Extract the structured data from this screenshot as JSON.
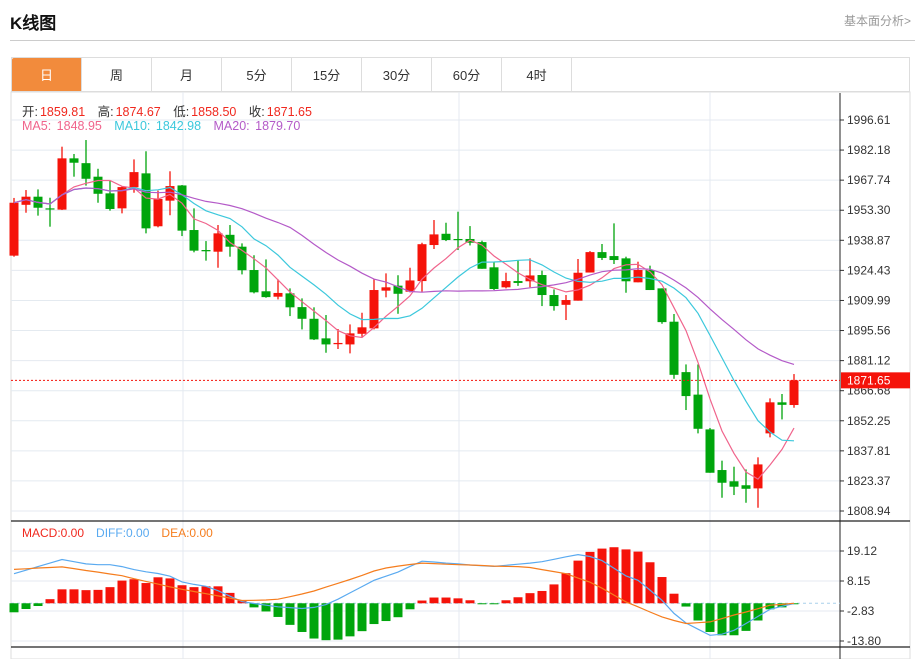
{
  "header": {
    "title": "K线图",
    "link": "基本面分析>"
  },
  "tabs": [
    {
      "label": "日",
      "active": true
    },
    {
      "label": "周"
    },
    {
      "label": "月"
    },
    {
      "label": "5分"
    },
    {
      "label": "15分"
    },
    {
      "label": "30分"
    },
    {
      "label": "60分"
    },
    {
      "label": "4时"
    }
  ],
  "ohlc_legend": {
    "open_label": "开:",
    "open": "1859.81",
    "high_label": "高:",
    "high": "1874.67",
    "low_label": "低:",
    "low": "1858.50",
    "close_label": "收:",
    "close": "1871.65"
  },
  "ma_legend": {
    "ma5_label": "MA5:",
    "ma5": "1848.95",
    "ma10_label": "MA10:",
    "ma10": "1842.98",
    "ma20_label": "MA20:",
    "ma20": "1879.70"
  },
  "macd_legend": {
    "macd": "MACD:0.00",
    "diff": "DIFF:0.00",
    "dea": "DEA:0.00"
  },
  "colors": {
    "up": "#f5130a",
    "down": "#00a50c",
    "ma5": "#f0648c",
    "ma10": "#3cc8dc",
    "ma20": "#b45ac8",
    "diff": "#5aaaf0",
    "dea": "#f57d1e",
    "accent": "#f28b3c",
    "last_price": "#f5130a"
  },
  "chart_data": [
    {
      "type": "candlestick",
      "title": "",
      "ylim": [
        1808.94,
        1996.61
      ],
      "y_ticks": [
        "1996.61",
        "1982.18",
        "1967.74",
        "1953.30",
        "1938.87",
        "1924.43",
        "1909.99",
        "1895.56",
        "1881.12",
        "1866.68",
        "1852.25",
        "1837.81",
        "1823.37",
        "1808.94"
      ],
      "last_price": "1871.65",
      "grid": true,
      "ma_periods": [
        5,
        10,
        20
      ],
      "candles": [
        [
          1931.5,
          1959.2,
          1931.0,
          1956.9
        ],
        [
          1955.9,
          1963.0,
          1952.1,
          1959.8
        ],
        [
          1959.8,
          1963.3,
          1950.7,
          1954.5
        ],
        [
          1954.2,
          1959.3,
          1945.4,
          1954.0
        ],
        [
          1953.6,
          1983.8,
          1953.4,
          1978.2
        ],
        [
          1978.2,
          1980.3,
          1969.4,
          1976.1
        ],
        [
          1975.9,
          1987.0,
          1965.1,
          1968.4
        ],
        [
          1969.4,
          1973.2,
          1956.9,
          1961.2
        ],
        [
          1961.4,
          1967.5,
          1953.1,
          1953.9
        ],
        [
          1954.2,
          1964.9,
          1951.8,
          1964.4
        ],
        [
          1964.3,
          1977.7,
          1961.7,
          1971.6
        ],
        [
          1971.0,
          1981.6,
          1942.2,
          1944.6
        ],
        [
          1945.6,
          1962.7,
          1945.1,
          1958.7
        ],
        [
          1957.9,
          1972.0,
          1950.9,
          1964.9
        ],
        [
          1965.2,
          1965.4,
          1940.9,
          1943.5
        ],
        [
          1943.8,
          1954.2,
          1933.1,
          1933.9
        ],
        [
          1934.2,
          1938.5,
          1929.1,
          1933.6
        ],
        [
          1933.4,
          1946.2,
          1925.7,
          1942.2
        ],
        [
          1941.5,
          1946.2,
          1931.0,
          1935.8
        ],
        [
          1935.8,
          1937.4,
          1922.5,
          1924.5
        ],
        [
          1924.6,
          1931.7,
          1913.4,
          1913.9
        ],
        [
          1914.4,
          1929.7,
          1911.3,
          1911.6
        ],
        [
          1911.8,
          1920.1,
          1910.5,
          1913.6
        ],
        [
          1913.4,
          1915.8,
          1902.5,
          1906.7
        ],
        [
          1906.8,
          1911.0,
          1896.1,
          1901.2
        ],
        [
          1901.2,
          1906.7,
          1891.0,
          1891.3
        ],
        [
          1891.8,
          1903.0,
          1884.9,
          1888.9
        ],
        [
          1889.0,
          1896.3,
          1886.7,
          1889.6
        ],
        [
          1888.9,
          1898.5,
          1884.6,
          1894.2
        ],
        [
          1894.0,
          1904.1,
          1892.6,
          1897.1
        ],
        [
          1896.6,
          1920.1,
          1896.1,
          1915.0
        ],
        [
          1914.7,
          1923.0,
          1911.5,
          1916.3
        ],
        [
          1917.1,
          1922.1,
          1903.6,
          1913.2
        ],
        [
          1914.2,
          1925.7,
          1913.9,
          1919.6
        ],
        [
          1919.3,
          1937.7,
          1914.2,
          1937.0
        ],
        [
          1936.6,
          1948.6,
          1934.7,
          1941.7
        ],
        [
          1942.0,
          1947.3,
          1938.5,
          1939.0
        ],
        [
          1939.5,
          1952.6,
          1934.2,
          1939.3
        ],
        [
          1939.5,
          1945.7,
          1936.4,
          1937.7
        ],
        [
          1938.0,
          1938.7,
          1925.2,
          1925.2
        ],
        [
          1925.9,
          1928.6,
          1915.0,
          1915.5
        ],
        [
          1916.3,
          1923.3,
          1915.8,
          1919.3
        ],
        [
          1919.3,
          1929.4,
          1917.0,
          1918.4
        ],
        [
          1919.2,
          1930.2,
          1916.3,
          1922.0
        ],
        [
          1922.2,
          1924.3,
          1907.3,
          1912.6
        ],
        [
          1912.6,
          1915.3,
          1905.1,
          1907.3
        ],
        [
          1907.9,
          1912.6,
          1900.6,
          1910.2
        ],
        [
          1909.9,
          1929.9,
          1909.9,
          1923.3
        ],
        [
          1923.4,
          1933.7,
          1923.4,
          1933.2
        ],
        [
          1933.2,
          1937.1,
          1929.4,
          1930.4
        ],
        [
          1931.3,
          1947.0,
          1927.5,
          1929.4
        ],
        [
          1930.2,
          1931.0,
          1913.7,
          1919.2
        ],
        [
          1918.7,
          1928.6,
          1918.7,
          1924.6
        ],
        [
          1924.6,
          1926.7,
          1915.0,
          1915.0
        ],
        [
          1915.8,
          1915.8,
          1898.8,
          1899.6
        ],
        [
          1899.8,
          1903.5,
          1872.4,
          1874.3
        ],
        [
          1875.6,
          1879.3,
          1857.4,
          1864.1
        ],
        [
          1864.8,
          1879.3,
          1846.2,
          1848.4
        ],
        [
          1848.1,
          1848.8,
          1827.3,
          1827.3
        ],
        [
          1828.6,
          1833.1,
          1815.3,
          1822.5
        ],
        [
          1823.2,
          1830.2,
          1816.6,
          1820.6
        ],
        [
          1821.3,
          1828.9,
          1812.9,
          1819.6
        ],
        [
          1819.8,
          1834.7,
          1810.5,
          1831.3
        ],
        [
          1846.2,
          1863.0,
          1844.3,
          1861.1
        ],
        [
          1861.1,
          1865.1,
          1852.9,
          1859.9
        ],
        [
          1859.81,
          1874.67,
          1858.5,
          1871.65
        ]
      ]
    },
    {
      "type": "bar+line",
      "title": "",
      "ylim": [
        -13.8,
        19.12
      ],
      "y_ticks": [
        "19.12",
        "8.15",
        "-2.83",
        "-13.80"
      ],
      "macd": [
        -3.3,
        -2.1,
        -1.0,
        1.5,
        5.1,
        5.1,
        4.8,
        4.9,
        5.9,
        8.3,
        8.8,
        7.4,
        9.5,
        9.1,
        6.6,
        5.9,
        6.2,
        6.2,
        3.8,
        1.0,
        -1.5,
        -3.0,
        -5.0,
        -7.9,
        -10.5,
        -12.9,
        -13.5,
        -13.3,
        -12.1,
        -10.2,
        -7.6,
        -6.5,
        -5.1,
        -2.2,
        1.0,
        2.1,
        2.1,
        1.8,
        1.1,
        -0.1,
        -0.1,
        1.1,
        2.2,
        3.7,
        4.5,
        6.9,
        11.0,
        15.6,
        18.8,
        20.0,
        20.5,
        19.7,
        18.9,
        15.0,
        9.6,
        3.5,
        -1.2,
        -6.3,
        -10.5,
        -11.7,
        -11.7,
        -10.1,
        -6.3,
        -2.2,
        -1.5,
        -0.1
      ],
      "diff": [
        10.8,
        12.1,
        13.4,
        14.7,
        16.0,
        15.2,
        14.4,
        14.1,
        14.1,
        13.4,
        12.3,
        11.5,
        10.9,
        9.9,
        7.8,
        6.9,
        6.2,
        4.6,
        2.6,
        0.6,
        -0.1,
        -0.7,
        -1.3,
        -1.6,
        -1.9,
        -1.5,
        -0.5,
        1.5,
        3.8,
        6.1,
        8.4,
        9.9,
        11.4,
        13.5,
        15.4,
        15.1,
        14.7,
        14.4,
        14.0,
        13.7,
        13.5,
        13.9,
        14.3,
        14.7,
        15.2,
        16.1,
        17.0,
        17.8,
        17.1,
        15.6,
        12.8,
        10.0,
        8.4,
        4.8,
        1.1,
        -3.7,
        -7.2,
        -9.5,
        -11.7,
        -11.3,
        -9.9,
        -7.4,
        -4.8,
        -2.2,
        -1.1,
        -0.1
      ],
      "dea": [
        12.4,
        12.6,
        12.9,
        13.1,
        13.3,
        12.7,
        12.0,
        11.4,
        10.7,
        10.1,
        9.0,
        8.0,
        7.0,
        6.0,
        5.1,
        4.3,
        3.5,
        2.7,
        1.9,
        1.0,
        1.1,
        1.2,
        1.5,
        2.4,
        3.4,
        4.5,
        5.9,
        7.3,
        8.7,
        10.2,
        11.8,
        12.9,
        13.6,
        14.2,
        14.7,
        14.5,
        14.3,
        14.1,
        14.0,
        13.8,
        13.6,
        13.5,
        13.4,
        13.1,
        12.3,
        11.6,
        10.8,
        9.2,
        7.7,
        5.5,
        3.0,
        0.5,
        -1.3,
        -3.2,
        -5.0,
        -6.3,
        -7.4,
        -7.1,
        -6.8,
        -5.6,
        -4.3,
        -3.2,
        -2.0,
        -0.7,
        -0.4,
        0
      ]
    }
  ]
}
